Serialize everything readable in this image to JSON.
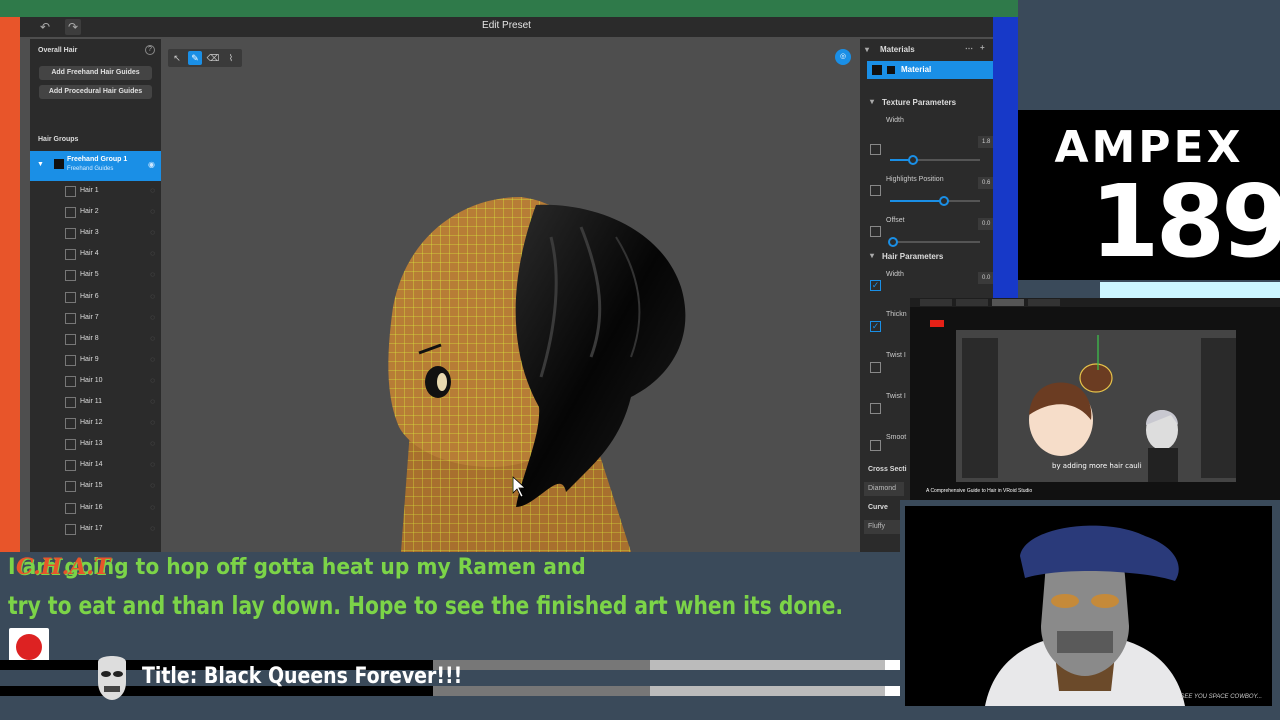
{
  "window": {
    "title": "Edit Preset"
  },
  "left_panel": {
    "header": "Overall Hair",
    "btn_freehand": "Add Freehand Hair Guides",
    "btn_procedural": "Add Procedural Hair Guides",
    "groups_header": "Hair Groups",
    "group": {
      "name": "Freehand Group 1",
      "sub": "Freehand Guides"
    },
    "hairs": [
      "Hair 1",
      "Hair 2",
      "Hair 3",
      "Hair 4",
      "Hair 5",
      "Hair 6",
      "Hair 7",
      "Hair 8",
      "Hair 9",
      "Hair 10",
      "Hair 11",
      "Hair 12",
      "Hair 13",
      "Hair 14",
      "Hair 15",
      "Hair 16",
      "Hair 17"
    ]
  },
  "right_panel": {
    "materials_header": "Materials",
    "material_name": "Material",
    "texture_header": "Texture Parameters",
    "width_label": "Width",
    "width_value": "1.8",
    "highlights_label": "Highlights Position",
    "highlights_value": "0.6",
    "offset_label": "Offset",
    "offset_value": "0.0",
    "hair_params_header": "Hair Parameters",
    "hp_width_label": "Width",
    "hp_width_value": "0.0",
    "thickness_label": "Thickn",
    "twist1_label": "Twist I",
    "twist2_label": "Twist I",
    "smooth_label": "Smoot",
    "cross_section_label": "Cross Secti",
    "cross_section_value": "Diamond",
    "curve_label": "Curve",
    "curve_value": "Fluffy"
  },
  "overlay": {
    "brand": "AMPEX",
    "number": "189",
    "pip_caption": "by adding more hair cauli",
    "pip_title": "A Comprehensive Guide to Hair in VRoid Studio",
    "cam_signature": "SEE YOU SPACE COWBOY..."
  },
  "chat": {
    "label": "C.H.A.T",
    "line1": "I am going to hop off gotta heat up my Ramen and",
    "line2": "try to eat and than lay down. Hope to see the finished art when its done."
  },
  "stream_title": "Title: Black Queens Forever!!!",
  "colors": {
    "accent": "#1a8fe6",
    "chat_green": "#7cd448",
    "frame_orange": "#e8552a",
    "frame_green": "#2f7a4a"
  },
  "icons": {
    "undo": "undo-icon",
    "redo": "redo-icon",
    "select": "cursor-icon",
    "brush": "pen-icon",
    "eraser": "eraser-icon",
    "lasso": "lasso-icon"
  }
}
